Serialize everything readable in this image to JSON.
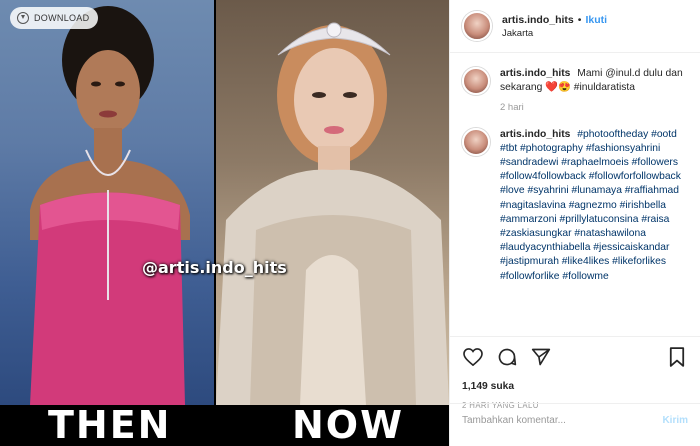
{
  "photo": {
    "download_label": "DOWNLOAD",
    "left_caption": "THEN",
    "right_caption": "NOW",
    "watermark": "@artis.indo_hits"
  },
  "header": {
    "username": "artis.indo_hits",
    "separator": "•",
    "follow_label": "Ikuti",
    "location": "Jakarta"
  },
  "comments": [
    {
      "username": "artis.indo_hits",
      "text": "Mami @inul.d dulu dan sekarang ❤️😍 #inuldaratista",
      "time": "2 hari"
    },
    {
      "username": "artis.indo_hits",
      "text": "#photooftheday #ootd #tbt #photography #fashionsyahrini #sandradewi #raphaelmoeis #followers #follow4followback #followforfollowback #love #syahrini #lunamaya #raffiahmad #nagitaslavina #agnezmo #irishbella #ammarzoni #prillylatuconsina #raisa #zaskiasungkar #natashawilona #laudyacynthiabella #jessicaiskandar #jastipmurah #like4likes #likeforlikes #followforlike #followme"
    }
  ],
  "actions": {
    "likes": "1,149 suka",
    "post_date": "2 HARI YANG LALU",
    "comment_placeholder": "Tambahkan komentar...",
    "post_label": "Kirim"
  },
  "colors": {
    "link": "#003569",
    "follow": "#3897f0",
    "muted": "#999999"
  }
}
